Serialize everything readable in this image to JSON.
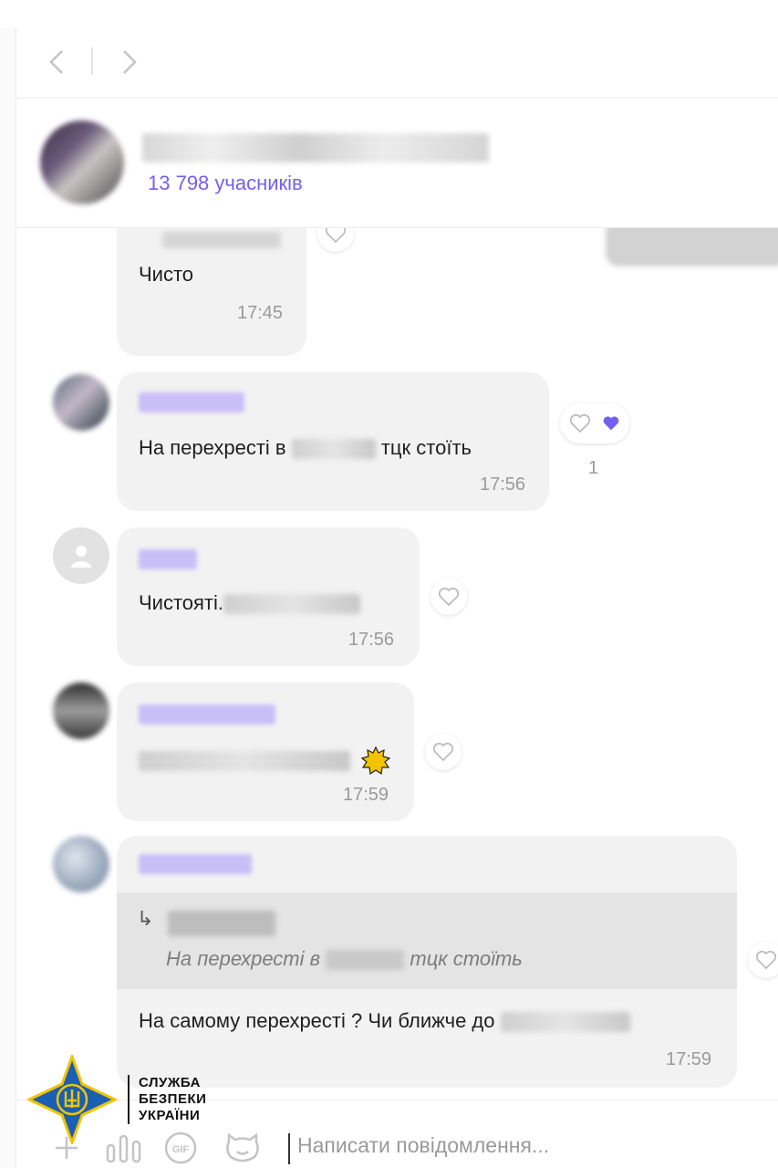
{
  "header": {
    "members": "13 798 учасників"
  },
  "messages": [
    {
      "text": "Чисто",
      "time": "17:45"
    },
    {
      "text_before": "На перехресті в",
      "text_after": "тцк стоїть",
      "time": "17:56",
      "reaction_count": "1"
    },
    {
      "text": "Чистоятi.",
      "time": "17:56"
    },
    {
      "text": "",
      "time": "17:59",
      "emoji": "sun"
    },
    {
      "quote_arrow": "↳",
      "quote_before": "На перехресті в",
      "quote_after": "тцк стоїть",
      "text": "На самому перехресті ? Чи ближче до",
      "time": "17:59"
    }
  ],
  "watermark": {
    "line1": "СЛУЖБА",
    "line2": "БЕЗПЕКИ",
    "line3": "УКРАЇНИ"
  },
  "composer": {
    "placeholder": "Написати повідомлення...",
    "gif_label": "GIF"
  },
  "colors": {
    "accent": "#7360f2",
    "bubble": "#f2f2f2",
    "sbu_blue": "#1a5fb4",
    "sbu_gold": "#f2c300"
  },
  "icons": [
    "back-arrow-icon",
    "forward-arrow-icon",
    "heart-icon",
    "heart-filled-icon",
    "reply-arrow-icon",
    "plus-icon",
    "voice-icon",
    "gif-icon",
    "sticker-icon",
    "sun-emoji-icon"
  ]
}
